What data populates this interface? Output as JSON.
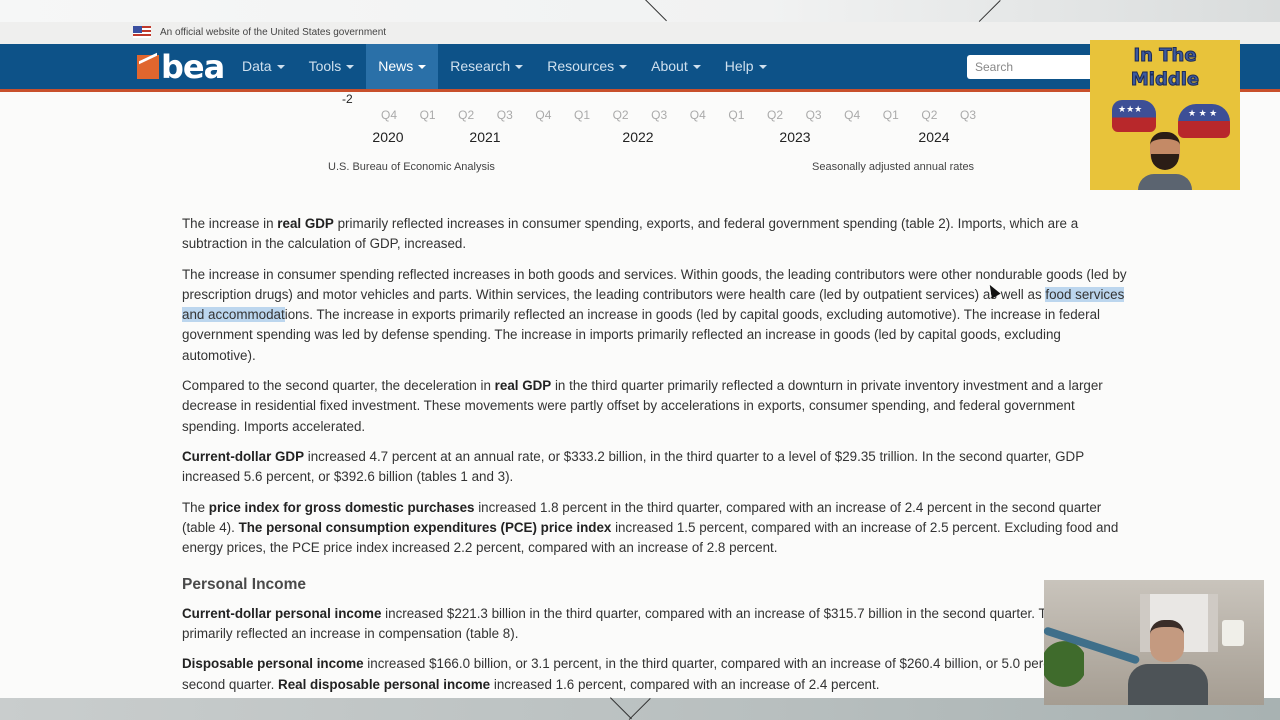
{
  "gov_banner": {
    "text": "An official website of the United States government"
  },
  "navbar": {
    "logo_text": "bea",
    "items": [
      {
        "label": "Data",
        "active": false
      },
      {
        "label": "Tools",
        "active": false
      },
      {
        "label": "News",
        "active": true
      },
      {
        "label": "Research",
        "active": false
      },
      {
        "label": "Resources",
        "active": false
      },
      {
        "label": "About",
        "active": false
      },
      {
        "label": "Help",
        "active": false
      }
    ],
    "search_placeholder": "Search",
    "accent_color": "#0d5288",
    "border_color": "#c8502c"
  },
  "chart_fragment": {
    "y_tick_visible": "-2",
    "quarters": [
      "Q4",
      "Q1",
      "Q2",
      "Q3",
      "Q4",
      "Q1",
      "Q2",
      "Q3",
      "Q4",
      "Q1",
      "Q2",
      "Q3",
      "Q4",
      "Q1",
      "Q2",
      "Q3"
    ],
    "years": [
      "2020",
      "2021",
      "2022",
      "2023",
      "2024"
    ],
    "source": "U.S. Bureau of Economic Analysis",
    "note": "Seasonally adjusted annual rates"
  },
  "article": {
    "p1": {
      "a": "The increase in ",
      "b1": "real GDP",
      "c": " primarily reflected increases in consumer spending, exports, and federal government spending (table 2). Imports, which are a subtraction in the calculation of GDP, increased."
    },
    "p2": {
      "a": "The increase in consumer spending reflected increases in both goods and services. Within goods, the leading contributors were other nondurable goods (led by prescription drugs) and motor vehicles and parts. Within services, the leading contributors were health care (led by outpatient services) as well as ",
      "highlight": "food services and accommodat",
      "c": "ions. The increase in exports primarily reflected an increase in goods (led by capital goods, excluding automotive). The increase in federal government spending was led by defense spending. The increase in imports primarily reflected an increase in goods (led by capital goods, excluding automotive)."
    },
    "p3": {
      "a": "Compared to the second quarter, the deceleration in ",
      "b1": "real GDP",
      "c": " in the third quarter primarily reflected a downturn in private inventory investment and a larger decrease in residential fixed investment. These movements were partly offset by accelerations in exports, consumer spending, and federal government spending. Imports accelerated."
    },
    "p4": {
      "b1": "Current-dollar GDP",
      "c": " increased 4.7 percent at an annual rate, or $333.2 billion, in the third quarter to a level of $29.35 trillion. In the second quarter, GDP increased 5.6 percent, or $392.6 billion (tables 1 and 3)."
    },
    "p5": {
      "a": "The ",
      "b1": "price index for gross domestic purchases",
      "c": " increased 1.8 percent in the third quarter, compared with an increase of 2.4 percent in the second quarter (table 4). ",
      "b2": "The personal consumption expenditures (PCE) price index",
      "d": " increased 1.5 percent, compared with an increase of 2.5 percent. Excluding food and energy prices, the PCE price index increased 2.2 percent, compared with an increase of 2.8 percent."
    },
    "section_heading": "Personal Income",
    "p6": {
      "b1": "Current-dollar personal income",
      "c": " increased $221.3 billion in the third quarter, compared with an increase of $315.7 billion in the second quarter. The increase primarily reflected an increase in compensation (table 8)."
    },
    "p7": {
      "b1": "Disposable personal income",
      "c": " increased $166.0 billion, or 3.1 percent, in the third quarter, compared with an increase of $260.4 billion, or 5.0 percent, in the second quarter. ",
      "b2": "Real disposable personal income",
      "d": " increased 1.6 percent, compared with an increase of 2.4 percent."
    }
  },
  "overlay": {
    "podcast_title_line1": "In The",
    "podcast_title_line2": "Middle"
  }
}
